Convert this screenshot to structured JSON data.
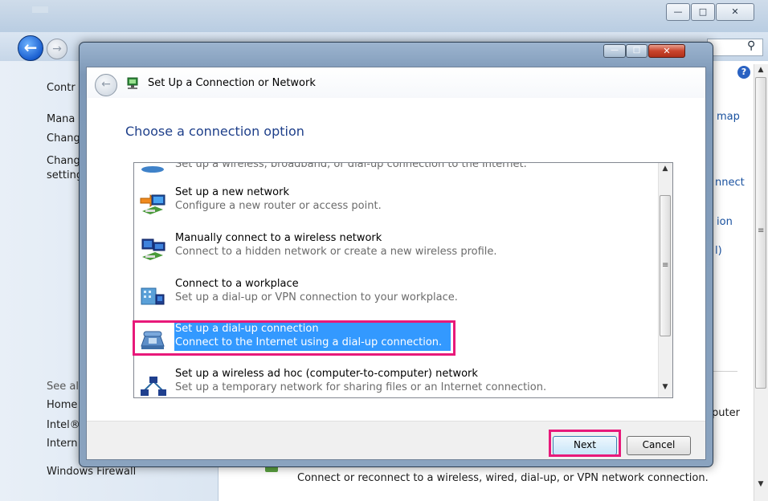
{
  "background": {
    "sidebar": {
      "control": "Contr",
      "manage": "Mana",
      "change1": "Chang",
      "change2": "Chang",
      "settings": "setting",
      "see_also": "See al",
      "home": "Home",
      "intel": "Intel®",
      "internet": "Intern",
      "firewall": "Windows Firewall"
    },
    "right_fragments": {
      "map": "map",
      "connect": "nnect",
      "ion": "ion",
      "paren": "l)",
      "computer": "puter"
    },
    "bottom_text": "Connect or reconnect to a wireless, wired, dial-up, or VPN network connection.",
    "search_icon": "search-icon"
  },
  "dialog": {
    "title": "Set Up a Connection or Network",
    "heading": "Choose a connection option",
    "options": [
      {
        "title": "Set up a wireless, broadband, or dial-up connection to the Internet.",
        "desc": ""
      },
      {
        "title": "Set up a new network",
        "desc": "Configure a new router or access point."
      },
      {
        "title": "Manually connect to a wireless network",
        "desc": "Connect to a hidden network or create a new wireless profile."
      },
      {
        "title": "Connect to a workplace",
        "desc": "Set up a dial-up or VPN connection to your workplace."
      },
      {
        "title": "Set up a dial-up connection",
        "desc": "Connect to the Internet using a dial-up connection."
      },
      {
        "title": "Set up a wireless ad hoc (computer-to-computer) network",
        "desc": "Set up a temporary network for sharing files or an Internet connection."
      }
    ],
    "selected_index": 4,
    "buttons": {
      "next": "Next",
      "cancel": "Cancel"
    }
  },
  "colors": {
    "selection": "#3399ff",
    "highlight_frame": "#e8197a",
    "heading": "#1e3f8a"
  }
}
